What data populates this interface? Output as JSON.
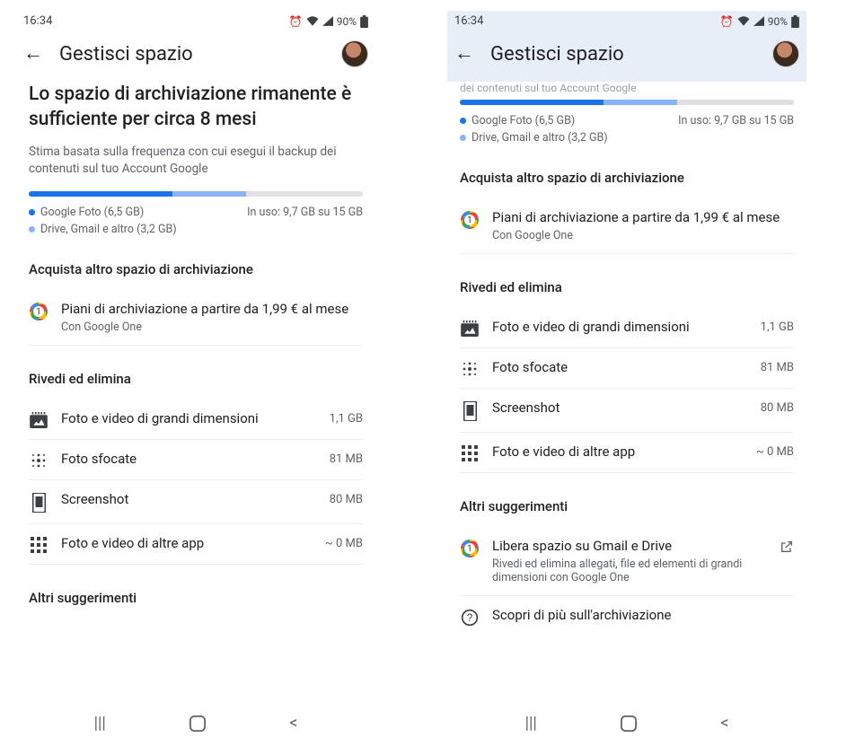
{
  "status": {
    "time": "16:34",
    "battery": "90%"
  },
  "appbar": {
    "title": "Gestisci spazio"
  },
  "left": {
    "headline": "Lo spazio di archiviazione rimanente è sufficiente per circa 8 mesi",
    "sub": "Stima basata sulla frequenza con cui esegui il backup dei contenuti sul tuo Account Google",
    "legend": {
      "photos": "Google Foto (6,5 GB)",
      "usage": "In uso: 9,7 GB su 15 GB",
      "drive": "Drive, Gmail e altro (3,2 GB)"
    },
    "buy": {
      "title": "Acquista altro spazio di archiviazione",
      "plan_primary": "Piani di archiviazione a partire da 1,99 € al mese",
      "plan_secondary": "Con Google One"
    },
    "review": {
      "title": "Rivedi ed elimina",
      "items": [
        {
          "label": "Foto e video di grandi dimensioni",
          "size": "1,1 GB"
        },
        {
          "label": "Foto sfocate",
          "size": "81 MB"
        },
        {
          "label": "Screenshot",
          "size": "80 MB"
        },
        {
          "label": "Foto e video di altre app",
          "size": "~ 0 MB"
        }
      ]
    },
    "other_title": "Altri suggerimenti"
  },
  "right": {
    "truncated_sub": "dei contenuti sul tuo Account Google",
    "legend": {
      "photos": "Google Foto (6,5 GB)",
      "usage": "In uso: 9,7 GB su 15 GB",
      "drive": "Drive, Gmail e altro (3,2 GB)"
    },
    "buy": {
      "title": "Acquista altro spazio di archiviazione",
      "plan_primary": "Piani di archiviazione a partire da 1,99 € al mese",
      "plan_secondary": "Con Google One"
    },
    "review": {
      "title": "Rivedi ed elimina",
      "items": [
        {
          "label": "Foto e video di grandi dimensioni",
          "size": "1,1 GB"
        },
        {
          "label": "Foto sfocate",
          "size": "81 MB"
        },
        {
          "label": "Screenshot",
          "size": "80 MB"
        },
        {
          "label": "Foto e video di altre app",
          "size": "~ 0 MB"
        }
      ]
    },
    "other": {
      "title": "Altri suggerimenti",
      "free_primary": "Libera spazio su Gmail e Drive",
      "free_secondary": "Rivedi ed elimina allegati, file ed elementi di grandi dimensioni con Google One",
      "learn": "Scopri di più sull'archiviazione"
    }
  }
}
